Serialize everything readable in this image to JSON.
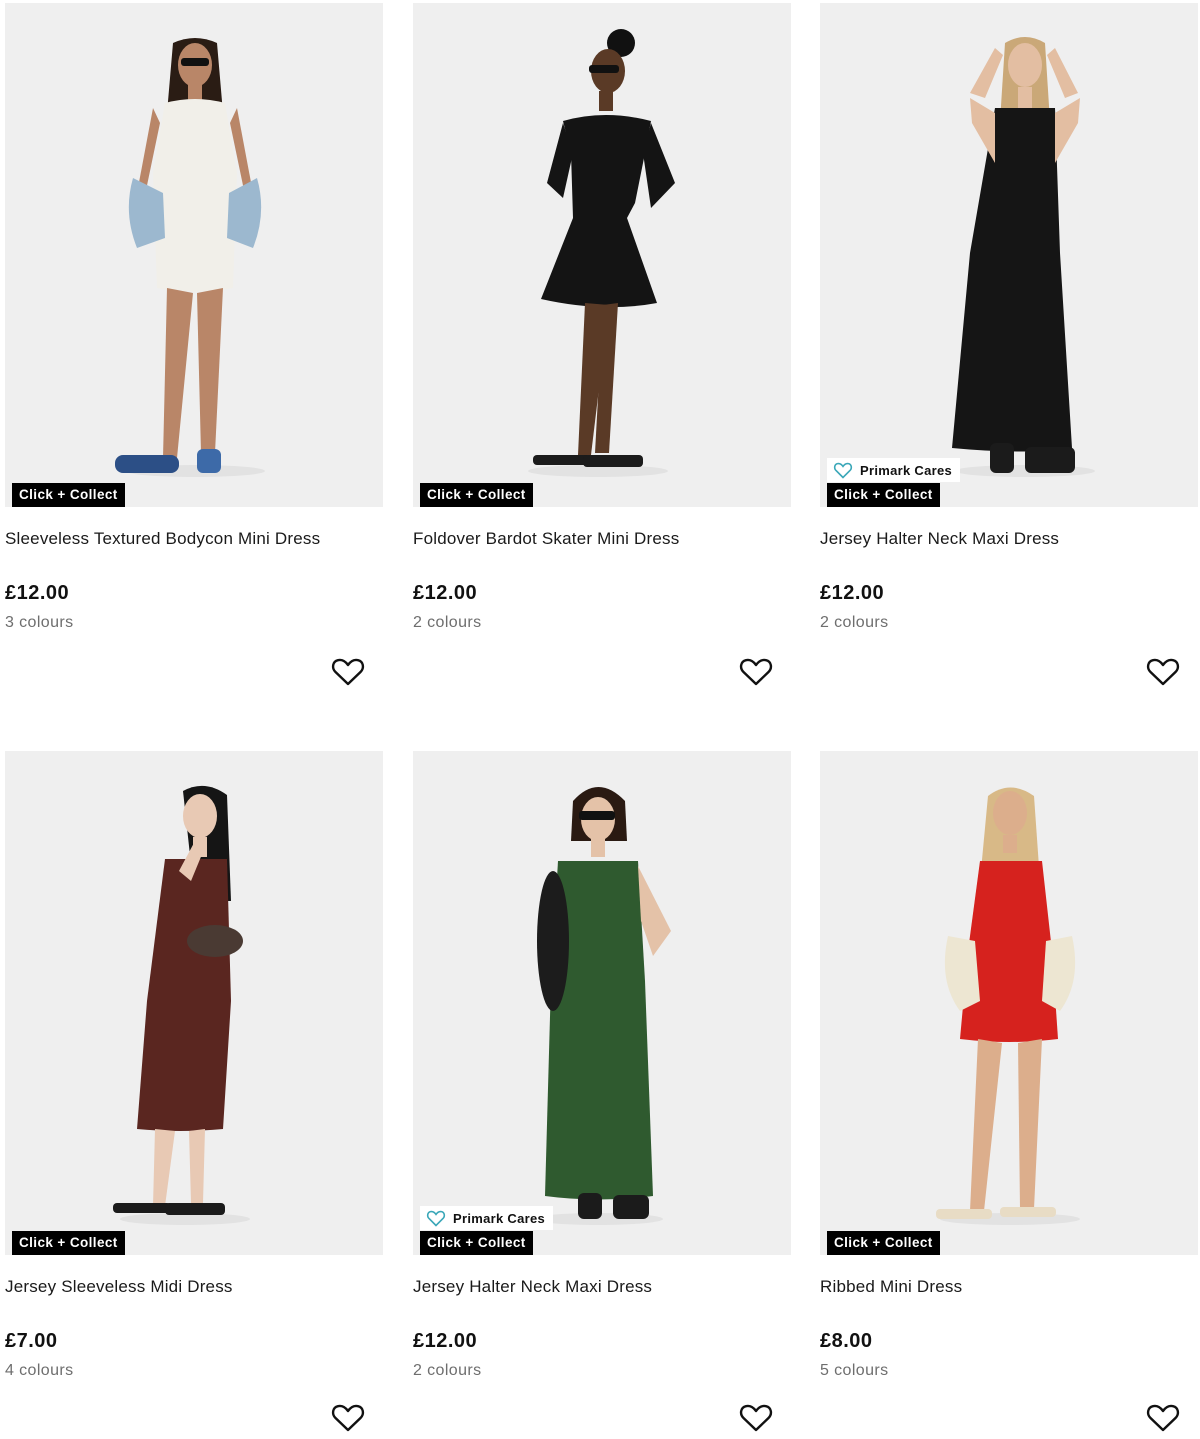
{
  "products": [
    {
      "title": "Sleeveless Textured Bodycon Mini Dress",
      "price": "£12.00",
      "colours": "3 colours",
      "badges": {
        "click_collect": "Click + Collect"
      },
      "dress_color": "#f1efe9",
      "skin_color": "#b98668",
      "hair_color": "#2a1c14"
    },
    {
      "title": "Foldover Bardot Skater Mini Dress",
      "price": "£12.00",
      "colours": "2 colours",
      "badges": {
        "click_collect": "Click + Collect"
      },
      "dress_color": "#141414",
      "skin_color": "#5a3a26",
      "hair_color": "#111111"
    },
    {
      "title": "Jersey Halter Neck Maxi Dress",
      "price": "£12.00",
      "colours": "2 colours",
      "badges": {
        "primark_cares": "Primark Cares",
        "click_collect": "Click + Collect"
      },
      "dress_color": "#151515",
      "skin_color": "#e3bea2",
      "hair_color": "#caa878"
    },
    {
      "title": "Jersey Sleeveless Midi Dress",
      "price": "£7.00",
      "colours": "4 colours",
      "badges": {
        "click_collect": "Click + Collect"
      },
      "dress_color": "#5a2620",
      "skin_color": "#e8c9b4",
      "hair_color": "#151515"
    },
    {
      "title": "Jersey Halter Neck Maxi Dress",
      "price": "£12.00",
      "colours": "2 colours",
      "badges": {
        "primark_cares": "Primark Cares",
        "click_collect": "Click + Collect"
      },
      "dress_color": "#2f5a2f",
      "skin_color": "#e4c2a8",
      "hair_color": "#2a1a12"
    },
    {
      "title": "Ribbed Mini Dress",
      "price": "£8.00",
      "colours": "5 colours",
      "badges": {
        "click_collect": "Click + Collect"
      },
      "dress_color": "#d6221e",
      "skin_color": "#dcae8c",
      "hair_color": "#d8b987"
    }
  ],
  "icons": {
    "favourite": "heart-outline-icon",
    "cares": "heart-outline-teal-icon"
  },
  "colors": {
    "cares_accent": "#3aa7b8",
    "badge_bg": "#000000",
    "image_bg": "#efefef"
  }
}
